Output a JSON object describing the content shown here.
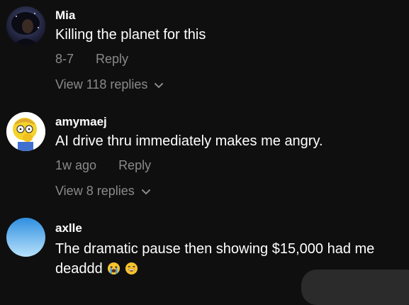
{
  "comments": [
    {
      "username": "Mia",
      "text": "Killing the planet for this",
      "time": "8-7",
      "reply": "Reply",
      "view_replies": "View 118 replies",
      "avatar_icon": "woman-silhouette-avatar"
    },
    {
      "username": "amymaej",
      "text": "AI drive thru immediately makes me angry.",
      "time": "1w ago",
      "reply": "Reply",
      "view_replies": "View 8 replies",
      "avatar_icon": "cartoon-boy-avatar"
    },
    {
      "username": "axlle",
      "text": "The dramatic pause then showing $15,000 had me deaddd",
      "emojis": [
        "loudly-crying-face-icon",
        "laughing-face-icon"
      ],
      "avatar_icon": "blue-gradient-avatar"
    }
  ],
  "colors": {
    "background": "#0f0f0f",
    "primary_text": "#ffffff",
    "secondary_text": "#8a8a8a"
  }
}
